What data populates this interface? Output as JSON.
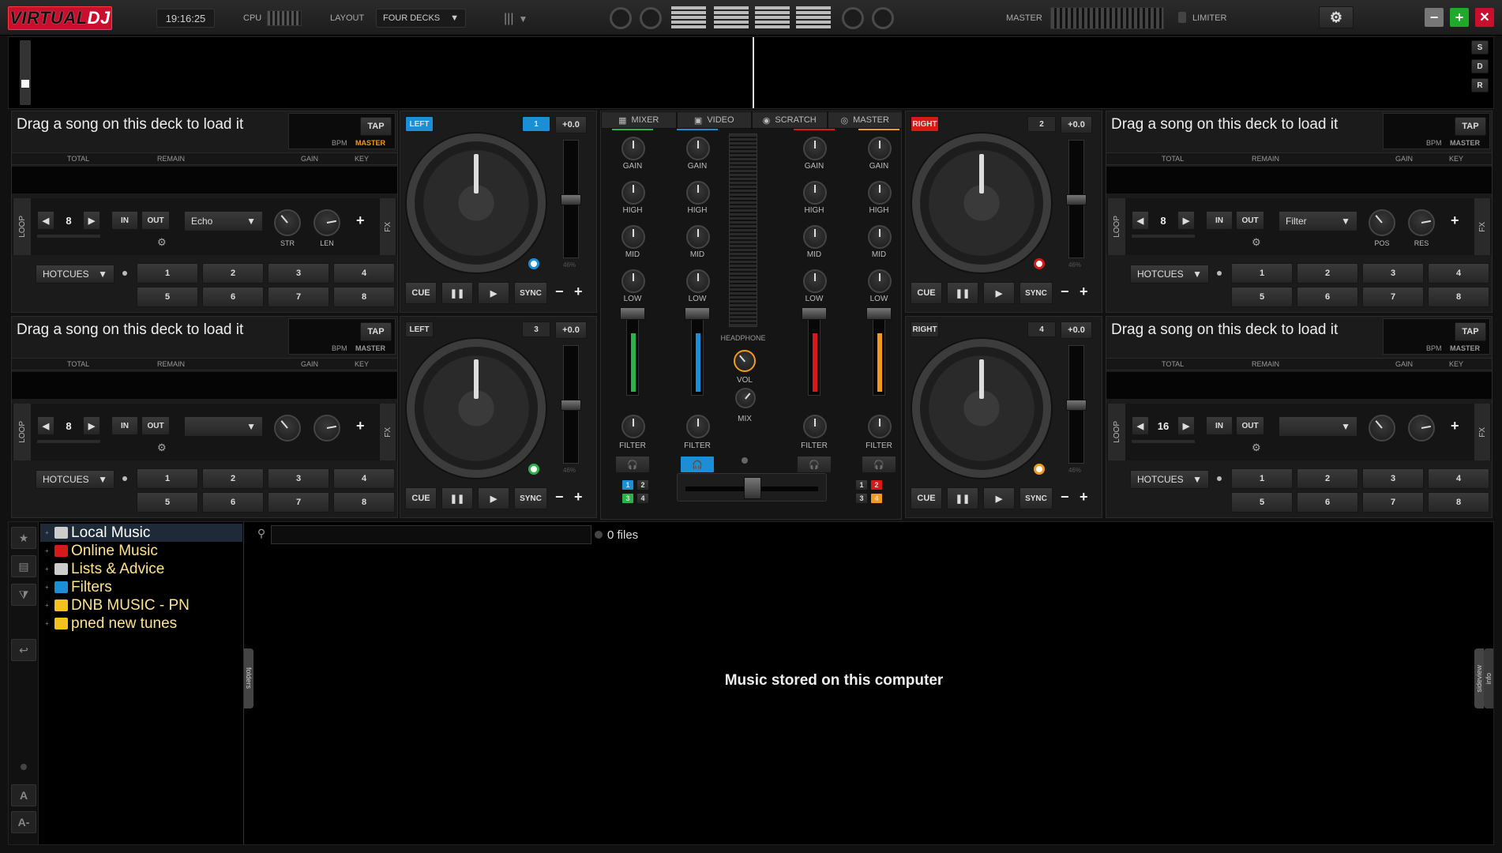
{
  "topbar": {
    "logo_left": "VIRTUAL",
    "logo_right": "DJ",
    "clock": "19:16:25",
    "cpu_label": "CPU",
    "layout_label": "LAYOUT",
    "layout_value": "FOUR DECKS",
    "master_label": "MASTER",
    "limiter_label": "LIMITER",
    "side_buttons": [
      "S",
      "D",
      "R"
    ]
  },
  "deck_common": {
    "empty_title": "Drag a song on this deck to load it",
    "tap": "TAP",
    "bpm": "BPM",
    "master": "MASTER",
    "total": "TOTAL",
    "remain": "REMAIN",
    "gain": "GAIN",
    "key": "KEY",
    "loop": "LOOP",
    "fx": "FX",
    "in": "IN",
    "out": "OUT",
    "hotcues": "HOTCUES",
    "hotcue_numbers": [
      "1",
      "2",
      "3",
      "4",
      "5",
      "6",
      "7",
      "8"
    ],
    "cue": "CUE",
    "sync": "SYNC",
    "pitch": "+0.0",
    "pitch_pct": "46%",
    "minus": "−",
    "plus": "+"
  },
  "decks": [
    {
      "side": "LEFT",
      "number": "1",
      "loop_size": "8",
      "effect": "Echo",
      "p1": "STR",
      "p2": "LEN",
      "active": true,
      "color": "#1a8fd6"
    },
    {
      "side": "RIGHT",
      "number": "2",
      "loop_size": "8",
      "effect": "Filter",
      "p1": "POS",
      "p2": "RES",
      "active": true,
      "color": "#d61a1a"
    },
    {
      "side": "LEFT",
      "number": "3",
      "loop_size": "8",
      "effect": "",
      "p1": "",
      "p2": "",
      "active": false,
      "color": "#2bb34a"
    },
    {
      "side": "RIGHT",
      "number": "4",
      "loop_size": "16",
      "effect": "",
      "p1": "",
      "p2": "",
      "active": false,
      "color": "#f39a1e"
    }
  ],
  "mixer": {
    "tabs": [
      "MIXER",
      "VIDEO",
      "SCRATCH",
      "MASTER"
    ],
    "knobs": [
      "GAIN",
      "HIGH",
      "MID",
      "LOW"
    ],
    "filter": "FILTER",
    "headphone": "HEADPHONE",
    "vol": "VOL",
    "mix": "MIX",
    "left_nums": [
      "1",
      "2",
      "3",
      "4"
    ],
    "right_nums": [
      "1",
      "2",
      "3",
      "4"
    ],
    "channel_colors": [
      "#2bb34a",
      "#1a8fd6",
      "#d61a1a",
      "#f39a1e"
    ],
    "channel_levels": [
      0.82,
      0.82,
      0.82,
      0.82
    ]
  },
  "browser": {
    "tree": [
      {
        "label": "Local Music",
        "color": "#ffffff"
      },
      {
        "label": "Online Music",
        "color": "#ffe38a"
      },
      {
        "label": "Lists & Advice",
        "color": "#ffe38a"
      },
      {
        "label": "Filters",
        "color": "#ffe38a"
      },
      {
        "label": "DNB MUSIC - PN",
        "color": "#ffe38a"
      },
      {
        "label": "pned new tunes",
        "color": "#ffe38a"
      }
    ],
    "search_placeholder": "",
    "files": "0 files",
    "center_msg": "Music stored on this computer",
    "folders_tab": "folders",
    "sideview_tab": "sideview",
    "info_tab": "info",
    "a_btn": "A",
    "a2_btn": "A-"
  }
}
